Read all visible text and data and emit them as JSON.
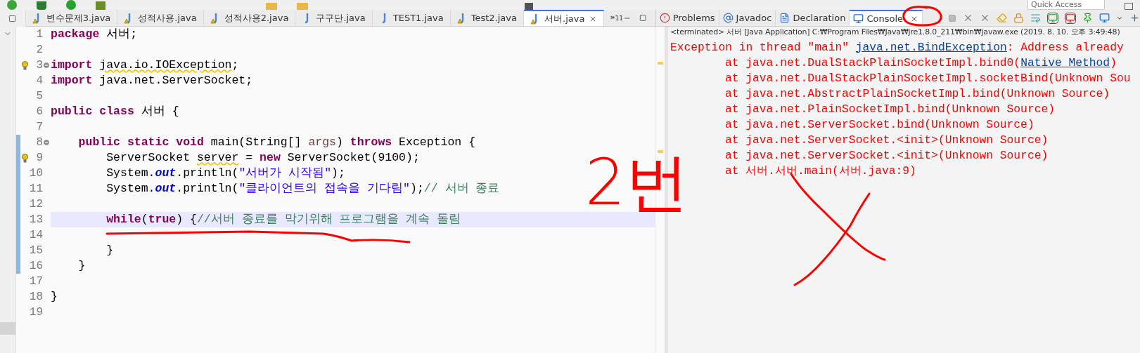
{
  "toolbar": {
    "quick_access": {
      "placeholder": "Quick Access"
    }
  },
  "editor": {
    "tabs": [
      {
        "label": "변수문제3.java",
        "warning": true,
        "selected": false
      },
      {
        "label": "성적사용.java",
        "warning": true,
        "selected": false
      },
      {
        "label": "성적사용2.java",
        "warning": true,
        "selected": false
      },
      {
        "label": "구구단.java",
        "warning": false,
        "selected": false
      },
      {
        "label": "TEST1.java",
        "warning": false,
        "selected": false
      },
      {
        "label": "Test2.java",
        "warning": true,
        "selected": false
      },
      {
        "label": "서버.java",
        "warning": true,
        "selected": true
      }
    ],
    "overflow": {
      "chevron": "»",
      "count": "11"
    },
    "lines": [
      {
        "number": "1",
        "tokens": [
          {
            "kind": "keyword",
            "text": "package"
          },
          {
            "kind": "text",
            "text": " 서버;"
          }
        ]
      },
      {
        "number": "2"
      },
      {
        "number": "3",
        "lightbulb": true,
        "fold": true,
        "tokens": [
          {
            "kind": "keyword",
            "text": "import "
          },
          {
            "kind": "warning",
            "text": "java.io.IOException"
          },
          {
            "kind": "text",
            "text": ";"
          }
        ]
      },
      {
        "number": "4",
        "tokens": [
          {
            "kind": "keyword",
            "text": "import"
          },
          {
            "kind": "text",
            "text": " java.net.ServerSocket;"
          }
        ]
      },
      {
        "number": "5"
      },
      {
        "number": "6",
        "tokens": [
          {
            "kind": "keyword",
            "text": "public class"
          },
          {
            "kind": "text",
            "text": " 서버 {"
          }
        ]
      },
      {
        "number": "7"
      },
      {
        "number": "8",
        "fold": true,
        "changed": true,
        "tokens": [
          {
            "kind": "keyword",
            "text": "    public static void"
          },
          {
            "kind": "text",
            "text": " main(String[] "
          },
          {
            "kind": "parameter",
            "text": "args"
          },
          {
            "kind": "text",
            "text": ") "
          },
          {
            "kind": "keyword",
            "text": "throws"
          },
          {
            "kind": "text",
            "text": " Exception {"
          }
        ]
      },
      {
        "number": "9",
        "lightbulb": true,
        "changed": true,
        "tokens": [
          {
            "kind": "text",
            "text": "        ServerSocket "
          },
          {
            "kind": "warning",
            "text": "server"
          },
          {
            "kind": "text",
            "text": " = "
          },
          {
            "kind": "keyword",
            "text": "new"
          },
          {
            "kind": "text",
            "text": " ServerSocket(9100);"
          }
        ]
      },
      {
        "number": "10",
        "changed": true,
        "tokens": [
          {
            "kind": "text",
            "text": "        System."
          },
          {
            "kind": "static-field",
            "text": "out"
          },
          {
            "kind": "text",
            "text": ".println("
          },
          {
            "kind": "string",
            "text": "\"서버가 시작됨\""
          },
          {
            "kind": "text",
            "text": ");"
          }
        ]
      },
      {
        "number": "11",
        "changed": true,
        "tokens": [
          {
            "kind": "text",
            "text": "        System."
          },
          {
            "kind": "static-field",
            "text": "out"
          },
          {
            "kind": "text",
            "text": ".println("
          },
          {
            "kind": "string",
            "text": "\"클라이언트의 접속을 기다림\""
          },
          {
            "kind": "text",
            "text": ");"
          },
          {
            "kind": "comment",
            "text": "// 서버 종료"
          }
        ]
      },
      {
        "number": "12",
        "changed": true
      },
      {
        "number": "13",
        "changed": true,
        "current": true,
        "tokens": [
          {
            "kind": "keyword",
            "text": "        while"
          },
          {
            "kind": "text",
            "text": "("
          },
          {
            "kind": "keyword",
            "text": "true"
          },
          {
            "kind": "text",
            "text": ") {"
          },
          {
            "kind": "comment",
            "text": "//서버 종료를 막기위해 프로그램을 계속 돌림"
          }
        ]
      },
      {
        "number": "14",
        "changed": true
      },
      {
        "number": "15",
        "changed": true,
        "tokens": [
          {
            "kind": "text",
            "text": "        }"
          }
        ]
      },
      {
        "number": "16",
        "changed": true,
        "tokens": [
          {
            "kind": "text",
            "text": "    }"
          }
        ]
      },
      {
        "number": "17"
      },
      {
        "number": "18",
        "tokens": [
          {
            "kind": "text",
            "text": "}"
          }
        ]
      },
      {
        "number": "19"
      }
    ]
  },
  "console": {
    "tabs": [
      {
        "label": "Problems",
        "selected": false
      },
      {
        "label": "Javadoc",
        "selected": false
      },
      {
        "label": "Declaration",
        "selected": false
      },
      {
        "label": "Console",
        "selected": true
      }
    ],
    "header": "<terminated> 서버 [Java Application] C:₩Program Files₩Java₩jre1.8.0_211₩bin₩javaw.exe (2019. 8. 10. 오후 3:49:48)",
    "lines": [
      {
        "indented": false,
        "tokens": [
          {
            "kind": "error",
            "text": "Exception in thread \"main\" "
          },
          {
            "kind": "link",
            "text": "java.net.BindException"
          },
          {
            "kind": "error",
            "text": ": Address already"
          }
        ]
      },
      {
        "indented": true,
        "tokens": [
          {
            "kind": "error",
            "text": "at java.net.DualStackPlainSocketImpl.bind0("
          },
          {
            "kind": "link",
            "text": "Native Method"
          },
          {
            "kind": "error",
            "text": ")"
          }
        ]
      },
      {
        "indented": true,
        "tokens": [
          {
            "kind": "error",
            "text": "at java.net.DualStackPlainSocketImpl.socketBind(Unknown Sou"
          }
        ]
      },
      {
        "indented": true,
        "tokens": [
          {
            "kind": "error",
            "text": "at java.net.AbstractPlainSocketImpl.bind(Unknown Source)"
          }
        ]
      },
      {
        "indented": true,
        "tokens": [
          {
            "kind": "error",
            "text": "at java.net.PlainSocketImpl.bind(Unknown Source)"
          }
        ]
      },
      {
        "indented": true,
        "tokens": [
          {
            "kind": "error",
            "text": "at java.net.ServerSocket.bind(Unknown Source)"
          }
        ]
      },
      {
        "indented": true,
        "tokens": [
          {
            "kind": "error",
            "text": "at java.net.ServerSocket.<init>(Unknown Source)"
          }
        ]
      },
      {
        "indented": true,
        "tokens": [
          {
            "kind": "error",
            "text": "at java.net.ServerSocket.<init>(Unknown Source)"
          }
        ]
      },
      {
        "indented": true,
        "tokens": [
          {
            "kind": "error",
            "text": "at 서버.서버.main(서버.java:9)"
          }
        ]
      }
    ]
  },
  "annotations": {
    "handwritten": "2번"
  }
}
